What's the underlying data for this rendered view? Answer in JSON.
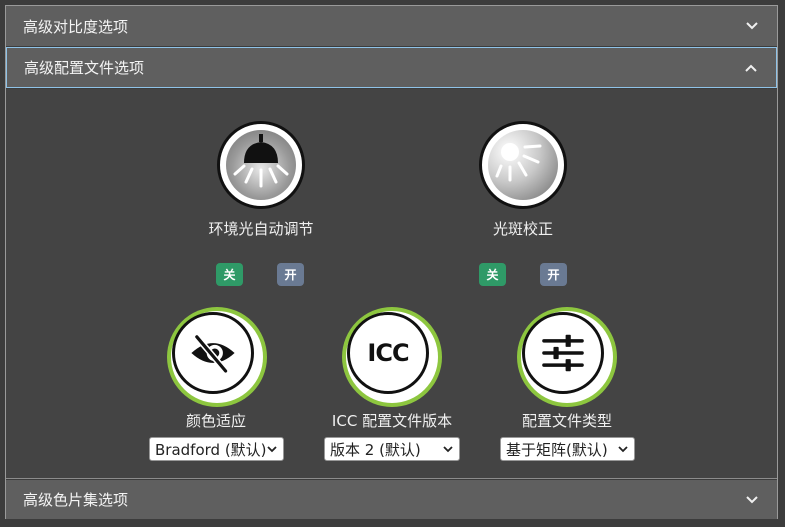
{
  "sections": {
    "advanced_contrast": {
      "label": "高级对比度选项",
      "expanded": false
    },
    "advanced_profile": {
      "label": "高级配置文件选项",
      "expanded": true
    },
    "advanced_patchset": {
      "label": "高级色片集选项",
      "expanded": false
    }
  },
  "features": [
    {
      "label": "环境光自动调节",
      "icon": "ceiling-lamp-icon",
      "toggle_off": "关",
      "toggle_on": "开",
      "state": "off"
    },
    {
      "label": "光斑校正",
      "icon": "sun-flare-icon",
      "toggle_off": "关",
      "toggle_on": "开",
      "state": "off"
    }
  ],
  "settings": [
    {
      "label": "颜色适应",
      "icon": "eye-slash-icon",
      "selected": "Bradford (默认)"
    },
    {
      "label": "ICC 配置文件版本",
      "icon": "icc-icon",
      "icon_text": "ICC",
      "selected": "版本 2 (默认)"
    },
    {
      "label": "配置文件类型",
      "icon": "sliders-icon",
      "selected": "基于矩阵(默认)"
    }
  ],
  "colors": {
    "header_bg": "#5f5f5f",
    "panel_bg": "#444444",
    "accent_ring": "#8dc63f",
    "toggle_off": "#2f9a67",
    "toggle_on": "#6a7a93",
    "focus_border": "#8fc3e8"
  }
}
